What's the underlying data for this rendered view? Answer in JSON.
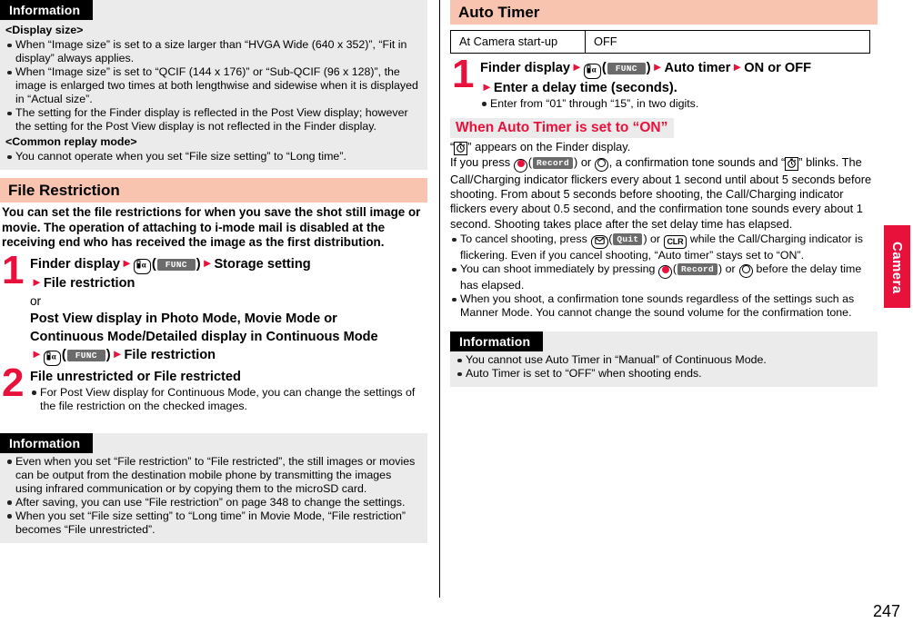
{
  "page_number": "247",
  "thumb_tab": {
    "label": "Camera",
    "color": "#e8113c"
  },
  "colors": {
    "section_header_bg": "#f8c3af",
    "info_bg": "#ebebeb",
    "accent_red": "#e8113c",
    "softkey_bg": "#6b6b6b"
  },
  "left_column": {
    "info_top": {
      "label": "Information",
      "groups": [
        {
          "heading": "<Display size>",
          "bullets": [
            "When “Image size” is set to a size larger than “HVGA Wide (640 x 352)”, “Fit in display” always applies.",
            "When “Image size” is set to “QCIF (144 x 176)” or “Sub-QCIF (96 x 128)”, the image is enlarged two times at both lengthwise and sidewise when it is displayed in “Actual size”.",
            "The setting for the Finder display is reflected in the Post View display; however the setting for the Post View display is not reflected in the Finder display."
          ]
        },
        {
          "heading": "<Common replay mode>",
          "bullets": [
            "You cannot operate when you set “File size setting” to “Long time”."
          ]
        }
      ]
    },
    "section": {
      "title": "File Restriction",
      "intro": "You can set the file restrictions for when you save the shot still image or movie. The operation of attaching to i-mode mail is disabled at the receiving end who has received the image as the first distribution.",
      "steps": [
        {
          "number": "1",
          "line1_a": "Finder display",
          "line1_b": "Storage setting",
          "line2": "File restriction",
          "or_label": "or",
          "alt_line1": "Post View display in Photo Mode, Movie Mode or",
          "alt_line2": "Continuous Mode/Detailed display in Continuous Mode",
          "alt_line3": "File restriction",
          "func_label": "FUNC"
        },
        {
          "number": "2",
          "title": "File unrestricted or File restricted",
          "notes": [
            "For Post View display for Continuous Mode, you can change the settings of the file restriction on the checked images."
          ]
        }
      ]
    },
    "info_bottom": {
      "label": "Information",
      "bullets": [
        "Even when you set “File restriction” to “File restricted”, the still images or movies can be output from the destination mobile phone by transmitting the images using infrared communication or by copying them to the microSD card.",
        "After saving, you can use “File restriction” on page 348 to change the settings.",
        "When you set “File size setting” to “Long time” in Movie Mode, “File restriction” becomes “File unrestricted”."
      ]
    }
  },
  "right_column": {
    "section": {
      "title": "Auto Timer",
      "table": {
        "rows": [
          {
            "key": "At Camera start-up",
            "value": "OFF"
          }
        ]
      },
      "steps": [
        {
          "number": "1",
          "line1_a": "Finder display",
          "line1_b": "Auto timer",
          "line1_c": "ON or OFF",
          "line2": "Enter a delay time (seconds).",
          "func_label": "FUNC",
          "notes": [
            "Enter from “01” through “15”, in two digits."
          ]
        }
      ]
    },
    "red_heading": "When Auto Timer is set to “ON”",
    "body": {
      "p1_a": "“",
      "p1_b": "” appears on the Finder display.",
      "p2_a": "If you press",
      "p2_record": "Record",
      "p2_b": ", a confirmation tone sounds and “",
      "p2_c": "” blinks. The Call/Charging indicator flickers every about 1 second until about 5 seconds before shooting. From about 5 seconds before shooting, the Call/Charging indicator flickers every about 0.5 second, and the confirmation tone sounds every about 1 second. Shooting takes place after the set delay time has elapsed.",
      "bullets": [
        {
          "a": "To cancel shooting, press",
          "softkey": "Quit",
          "clr": "CLR",
          "b": "while the Call/Charging indicator is flickering. Even if you cancel shooting, “Auto timer” stays set to “ON”."
        },
        {
          "a": "You can shoot immediately by pressing",
          "softkey": "Record",
          "b": "before the delay time has elapsed."
        },
        {
          "a": "When you shoot, a confirmation tone sounds regardless of the settings such as Manner Mode. You cannot change the sound volume for the confirmation tone.",
          "softkey": "",
          "b": ""
        }
      ]
    },
    "info": {
      "label": "Information",
      "bullets": [
        "You cannot use Auto Timer in “Manual” of Continuous Mode.",
        "Auto Timer is set to “OFF” when shooting ends."
      ]
    }
  }
}
